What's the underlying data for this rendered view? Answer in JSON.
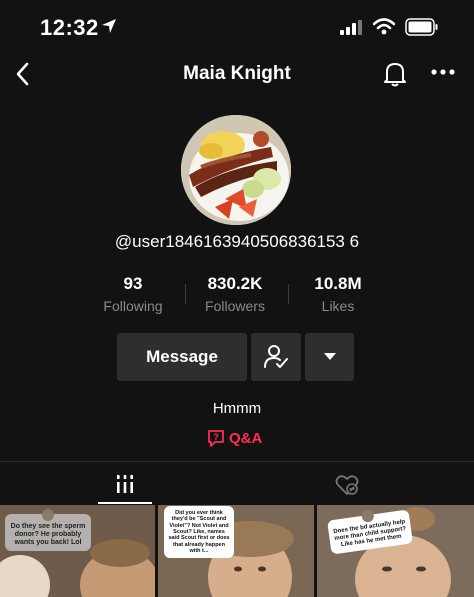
{
  "status_bar": {
    "time": "12:32",
    "icons": [
      "location-arrow-icon",
      "cellular-signal-icon",
      "wifi-icon",
      "battery-icon"
    ]
  },
  "nav": {
    "title": "Maia Knight",
    "icons": [
      "back-chevron-icon",
      "bell-icon",
      "more-dots-icon"
    ]
  },
  "profile": {
    "username": "@user1846163940506836153 6",
    "stats": [
      {
        "value": "93",
        "label": "Following"
      },
      {
        "value": "830.2K",
        "label": "Followers"
      },
      {
        "value": "10.8M",
        "label": "Likes"
      }
    ],
    "message_button": "Message",
    "bio": "Hmmm",
    "qa_label": "Q&A"
  },
  "tabs": [
    "videos-grid-icon",
    "liked-heart-icon"
  ],
  "videos": [
    {
      "sticker": "Do they see the sperm donor? He probably wants you back! Lol"
    },
    {
      "sticker": "Did you ever think they'd be \"Scout and Violet\"? Not Violet and Scout? Like, names said Scout first or does that already happen with t..."
    },
    {
      "sticker": "Does the bd actually help more than child support? Like has he met them"
    }
  ],
  "colors": {
    "background": "#121212",
    "button": "#2e2e2e",
    "accent": "#fe2c55",
    "secondary_text": "#8a8a8a"
  }
}
